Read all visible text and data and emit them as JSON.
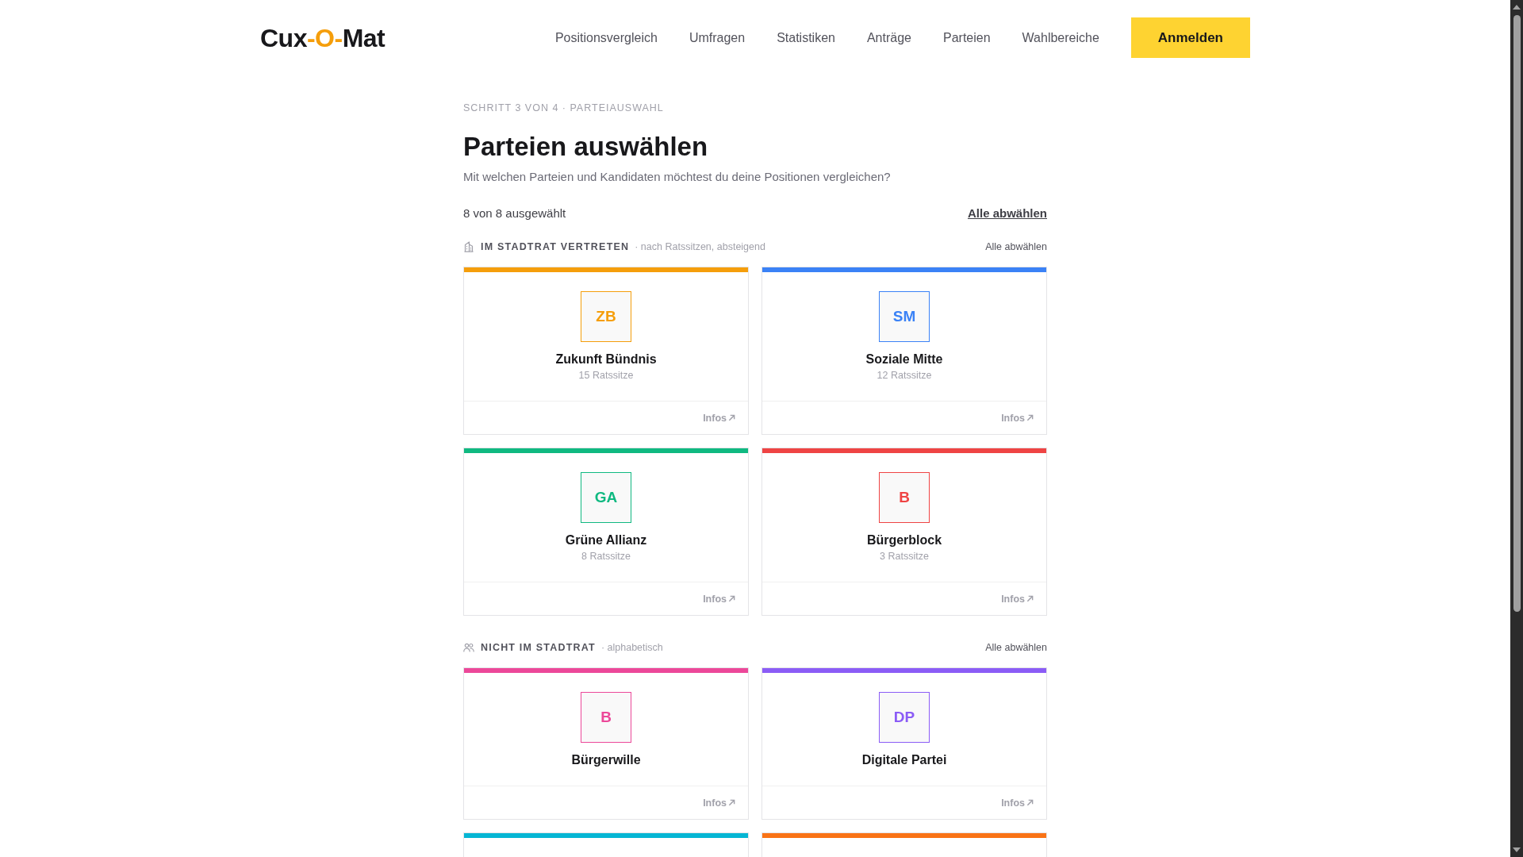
{
  "header": {
    "logo": [
      {
        "text": "Cux",
        "accent": false
      },
      {
        "text": "-O-",
        "accent": true
      },
      {
        "text": "Mat",
        "accent": false
      }
    ],
    "nav": [
      "Positionsvergleich",
      "Umfragen",
      "Statistiken",
      "Anträge",
      "Parteien",
      "Wahlbereiche"
    ],
    "login_button": "Anmelden"
  },
  "step_label": "SCHRITT 3 VON 4 · PARTEIAUSWAHL",
  "title": "Parteien auswählen",
  "subtitle": "Mit welchen Parteien und Kandidaten möchtest du deine Positionen vergleichen?",
  "selection": {
    "count": "8 von 8 ausgewählt",
    "deselect_all": "Alle abwählen"
  },
  "groups": [
    {
      "kind": "council",
      "title": "IM STADTRAT VERTRETEN",
      "sort": "· nach Ratssitzen, absteigend",
      "deselect_all": "Alle abwählen",
      "parties": [
        {
          "abbreviation": "ZB",
          "name": "Zukunft Bündnis",
          "seats": "15 Ratssitze",
          "color": "#f59e0b",
          "selected": true,
          "info_link": "Infos"
        },
        {
          "abbreviation": "SM",
          "name": "Soziale Mitte",
          "seats": "12 Ratssitze",
          "color": "#3b82f6",
          "selected": true,
          "info_link": "Infos"
        },
        {
          "abbreviation": "GA",
          "name": "Grüne Allianz",
          "seats": "8 Ratssitze",
          "color": "#10b981",
          "selected": true,
          "info_link": "Infos"
        },
        {
          "abbreviation": "B",
          "name": "Bürgerblock",
          "seats": "3 Ratssitze",
          "color": "#ef4444",
          "selected": true,
          "info_link": "Infos"
        }
      ]
    },
    {
      "kind": "non_council",
      "title": "NICHT IM STADTRAT",
      "sort": "· alphabetisch",
      "deselect_all": "Alle abwählen",
      "parties": [
        {
          "abbreviation": "B",
          "name": "Bürgerwille",
          "color": "#ec4899",
          "selected": true,
          "info_link": "Infos"
        },
        {
          "abbreviation": "DP",
          "name": "Digitale Partei",
          "color": "#8b5cf6",
          "selected": true,
          "info_link": "Infos"
        },
        {
          "color": "#06b6d4",
          "selected": true
        },
        {
          "color": "#f97316",
          "selected": true
        }
      ]
    }
  ]
}
